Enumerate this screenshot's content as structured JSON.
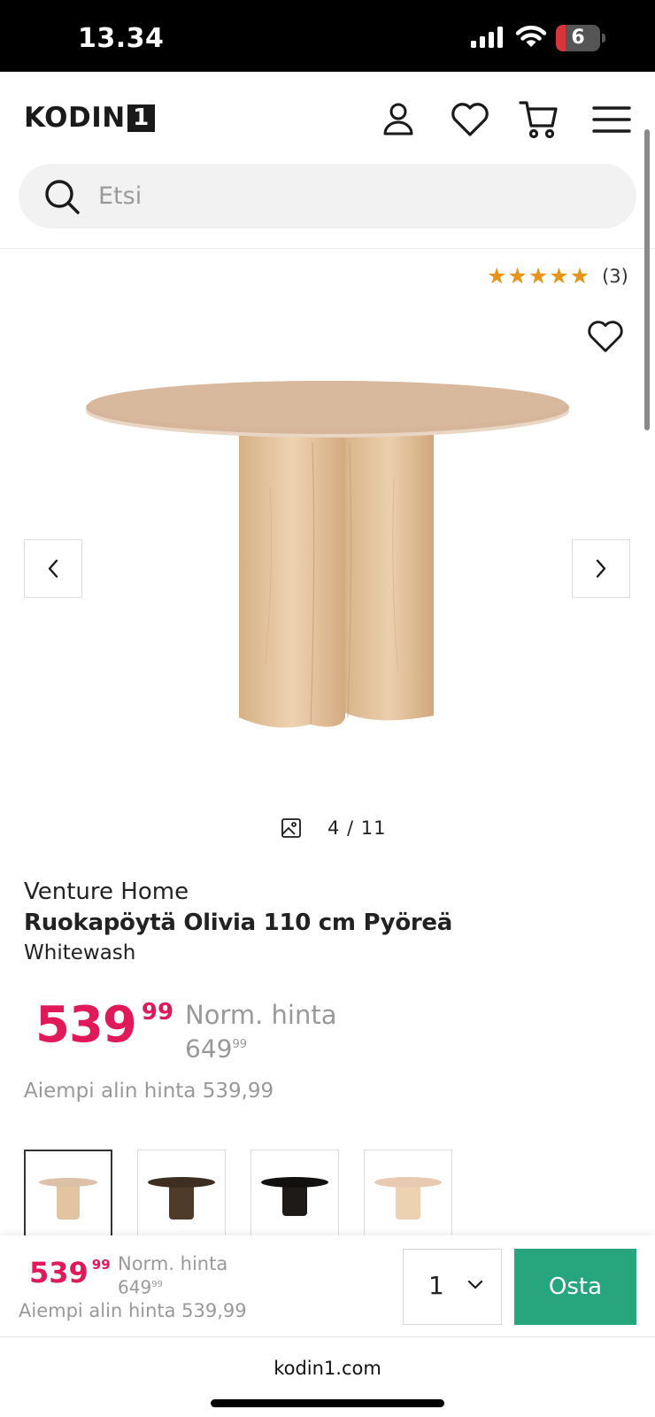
{
  "status_bar": {
    "time": "13.34",
    "battery": "6",
    "battery_level": 0.06
  },
  "header": {
    "logo_text": "KODIN",
    "logo_box": "1",
    "icons": [
      "user-icon",
      "heart-icon",
      "cart-icon",
      "menu-icon"
    ]
  },
  "search": {
    "placeholder": "Etsi"
  },
  "rating": {
    "stars": 5,
    "count": "(3)",
    "star_color": "#e8931a"
  },
  "gallery": {
    "counter": "4 / 11"
  },
  "product": {
    "brand": "Venture Home",
    "title": "Ruokapöytä Olivia 110 cm Pyöreä",
    "variant": "Whitewash",
    "price_int": "539",
    "price_dec": "99",
    "norm_label": "Norm. hinta",
    "norm_price_int": "649",
    "norm_price_dec": "99",
    "lowest_price": "Aiempi alin hinta 539,99",
    "price_color": "#e0195a"
  },
  "variants": [
    {
      "name": "whitewash",
      "selected": true
    },
    {
      "name": "dark-brown",
      "selected": false
    },
    {
      "name": "black",
      "selected": false
    },
    {
      "name": "natural",
      "selected": false
    }
  ],
  "buy_bar": {
    "price_int": "539",
    "price_dec": "99",
    "norm_label": "Norm. hinta",
    "norm_price_int": "649",
    "norm_price_dec": "99",
    "lowest_price": "Aiempi alin hinta 539,99",
    "quantity": "1",
    "buy_label": "Osta",
    "buy_color": "#27a57c"
  },
  "browser": {
    "domain": "kodin1.com"
  }
}
